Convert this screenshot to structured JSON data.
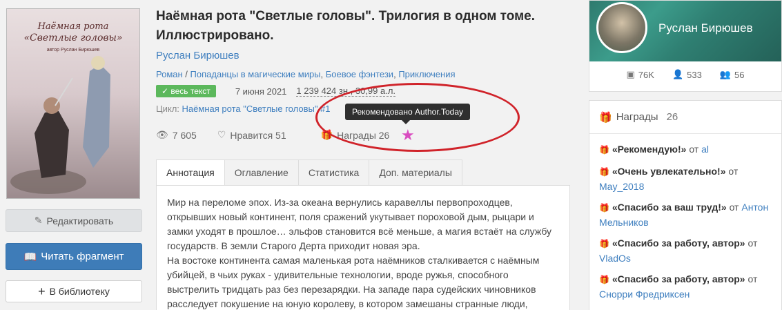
{
  "cover": {
    "title_line1": "Наёмная рота",
    "title_line2": "«Светлые головы»",
    "author_line": "автор Руслан Бирюшев"
  },
  "buttons": {
    "edit": "Редактировать",
    "read": "Читать фрагмент",
    "library": "В библиотеку"
  },
  "book": {
    "title": "Наёмная рота \"Светлые головы\". Трилогия в одном томе. Иллюстрировано.",
    "author": "Руслан Бирюшев",
    "genre_main": "Роман",
    "genre_sep": " / ",
    "genres": [
      "Попаданцы в магические миры",
      "Боевое фэнтези",
      "Приключения"
    ],
    "badge": "весь текст",
    "date": "7 июня 2021",
    "size": "1 239 424 зн., 30,99 а.л.",
    "cycle_label": "Цикл:",
    "cycle_name": "Наёмная рота \"Светлые головы\" #1",
    "views": "7 605",
    "likes": "Нравится 51",
    "rewards": "Награды 26",
    "tooltip": "Рекомендовано Author.Today"
  },
  "tabs": [
    "Аннотация",
    "Оглавление",
    "Статистика",
    "Доп. материалы"
  ],
  "annotation": [
    "Мир на переломе эпох. Из-за океана вернулись каравеллы первопроходцев, открывших новый континент, поля сражений укутывает пороховой дым, рыцари и замки уходят в прошлое… эльфов становится всё меньше, а магия встаёт на службу государств. В земли Старого Дерта приходит новая эра.",
    "На востоке континента самая маленькая рота наёмников сталкивается с наёмным убийцей, в чьих руках - удивительные технологии, вроде ружья, способного выстрелить тридцать раз без перезарядки. На западе пара судейских чиновников расследует покушение на юную королеву, в котором замешаны странные люди,"
  ],
  "profile": {
    "name": "Руслан Бирюшев",
    "stat1": "76K",
    "stat2": "533",
    "stat3": "56"
  },
  "awards": {
    "title": "Награды",
    "count": "26",
    "items": [
      {
        "name": "«Рекомендую!»",
        "from": "от",
        "user": "al"
      },
      {
        "name": "«Очень увлекательно!»",
        "from": "от",
        "user": "May_2018"
      },
      {
        "name": "«Спасибо за ваш труд!»",
        "from": "от",
        "user": "Антон Мельников"
      },
      {
        "name": "«Спасибо за работу, автор»",
        "from": "от",
        "user": "VladOs"
      },
      {
        "name": "«Спасибо за работу, автор»",
        "from": "от",
        "user": "Снорри Фредриксен"
      }
    ]
  },
  "colors": {
    "accent_blue": "#3e7cb8",
    "link": "#3f7fbf",
    "badge_green": "#5cb85c",
    "highlight_red": "#d0232a"
  }
}
